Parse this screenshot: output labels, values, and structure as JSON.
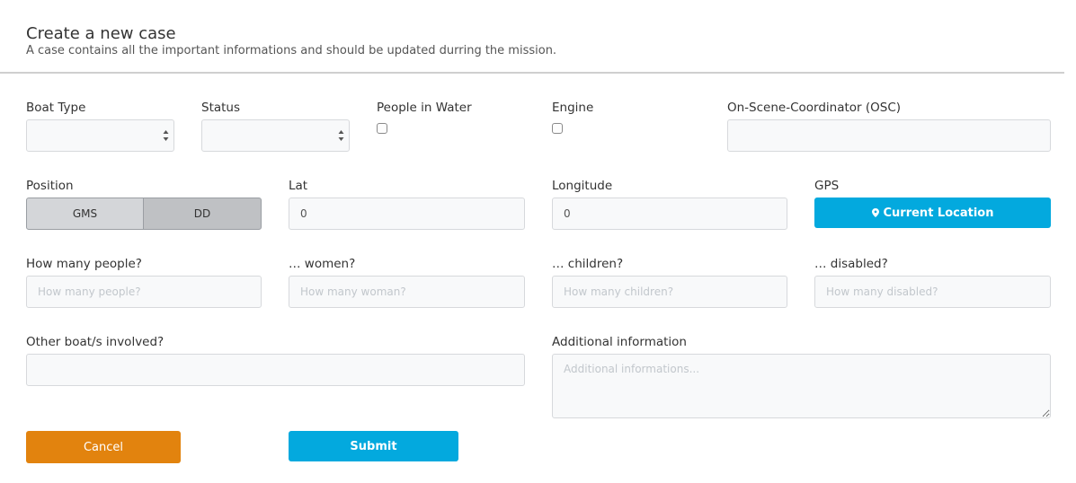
{
  "header": {
    "title": "Create a new case",
    "subtitle": "A case contains all the important informations and should be updated durring the mission."
  },
  "fields": {
    "boat_type": {
      "label": "Boat Type",
      "value": ""
    },
    "status": {
      "label": "Status",
      "value": ""
    },
    "people_in_water": {
      "label": "People in Water",
      "checked": false
    },
    "engine": {
      "label": "Engine",
      "checked": false
    },
    "osc": {
      "label": "On-Scene-Coordinator (OSC)",
      "value": ""
    },
    "position": {
      "label": "Position",
      "options": [
        "GMS",
        "DD"
      ],
      "selected": "DD"
    },
    "lat": {
      "label": "Lat",
      "value": "0"
    },
    "longitude": {
      "label": "Longitude",
      "value": "0"
    },
    "gps": {
      "label": "GPS",
      "button_label": "Current Location"
    },
    "people": {
      "label": "How many people?",
      "placeholder": "How many people?"
    },
    "women": {
      "label": "… women?",
      "placeholder": "How many woman?"
    },
    "children": {
      "label": "… children?",
      "placeholder": "How many children?"
    },
    "disabled": {
      "label": "… disabled?",
      "placeholder": "How many disabled?"
    },
    "other_boats": {
      "label": "Other boat/s involved?",
      "value": ""
    },
    "additional_info": {
      "label": "Additional information",
      "placeholder": "Additional informations..."
    }
  },
  "actions": {
    "cancel_label": "Cancel",
    "submit_label": "Submit"
  },
  "colors": {
    "accent_blue": "#03a9de",
    "cancel_orange": "#e2830e",
    "segment_gms": "#d4d6d9",
    "segment_dd_selected": "#bfc1c4"
  },
  "icons": {
    "gps_button": "map-marker-icon",
    "select_arrows": "sort-arrows-icon"
  }
}
